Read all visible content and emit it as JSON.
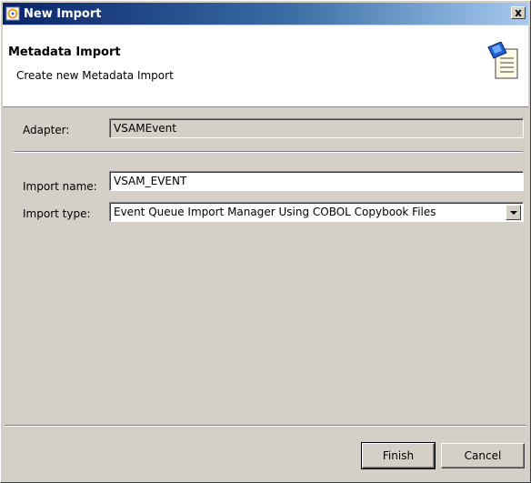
{
  "window": {
    "title": "New Import",
    "close_label": "x"
  },
  "header": {
    "title": "Metadata Import",
    "description": "Create new Metadata Import"
  },
  "form": {
    "adapter": {
      "label": "Adapter:",
      "value": "VSAMEvent"
    },
    "import_name": {
      "label": "Import name:",
      "value": "VSAM_EVENT"
    },
    "import_type": {
      "label": "Import type:",
      "value": "Event Queue Import Manager Using COBOL Copybook Files"
    }
  },
  "buttons": {
    "finish": "Finish",
    "cancel": "Cancel"
  },
  "icons": {
    "title": "app-icon",
    "header": "import-document-icon",
    "dropdown": "chevron-down-icon"
  }
}
